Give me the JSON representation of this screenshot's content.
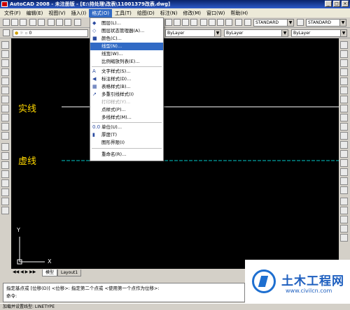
{
  "window": {
    "title": "AutoCAD 2008 - 未注册版 - [E:\\待处理\\改表\\11001379改表.dwg]",
    "min": "_",
    "max": "□",
    "close": "×"
  },
  "menubar": [
    "文件(F)",
    "编辑(E)",
    "视图(V)",
    "插入(I)",
    "格式(O)",
    "工具(T)",
    "绘图(D)",
    "标注(N)",
    "修改(M)",
    "窗口(W)",
    "帮助(H)"
  ],
  "toolbar": {
    "layer_value": "0",
    "color_value": "ByLayer",
    "linetype_value": "ByLayer",
    "lineweight_value": "ByLayer",
    "textstyle_value": "STANDARD",
    "dimstyle_value": "STANDARD"
  },
  "format_menu": {
    "items": [
      {
        "label": "图层(L)...",
        "icon": "layer-icon"
      },
      {
        "label": "图层状态管理器(A)...",
        "icon": "layer-state-icon"
      },
      {
        "label": "颜色(C)...",
        "icon": "color-icon"
      },
      {
        "label": "线型(N)...",
        "icon": "",
        "highlighted": true
      },
      {
        "label": "线宽(W)...",
        "icon": ""
      },
      {
        "label": "比例缩放列表(E)...",
        "icon": ""
      },
      {
        "label": "文字样式(S)...",
        "icon": "text-style-icon"
      },
      {
        "label": "标注样式(D)...",
        "icon": "dim-style-icon"
      },
      {
        "label": "表格样式(B)...",
        "icon": "table-style-icon"
      },
      {
        "label": "多重引线样式(I)",
        "icon": "mleader-icon"
      },
      {
        "label": "打印样式(Y)...",
        "icon": "",
        "disabled": true
      },
      {
        "label": "点样式(P)...",
        "icon": ""
      },
      {
        "label": "多线样式(M)...",
        "icon": ""
      },
      {
        "label": "单位(U)...",
        "icon": "units-icon"
      },
      {
        "label": "厚度(T)",
        "icon": "thickness-icon"
      },
      {
        "label": "图形界限(I)",
        "icon": ""
      },
      {
        "label": "重命名(R)...",
        "icon": ""
      }
    ]
  },
  "drawing": {
    "label_solid": "实线",
    "label_dashed": "虚线",
    "axis_y": "Y",
    "axis_x": "X",
    "colors": {
      "solid_line": "#ffffff",
      "dashed_line": "#00c8c8",
      "label": "#ffd800"
    }
  },
  "tabs": [
    "模型",
    "Layout1"
  ],
  "command": {
    "line1": "指定基点或 [位移(D)] <位移>:  指定第二个点或 <使用第一个点作为位移>:",
    "line2": "命令:"
  },
  "status": {
    "text": "加载并设置线型:  LINETYPE"
  },
  "watermark": {
    "title": "土木工程网",
    "url": "www.civilcn.com"
  }
}
